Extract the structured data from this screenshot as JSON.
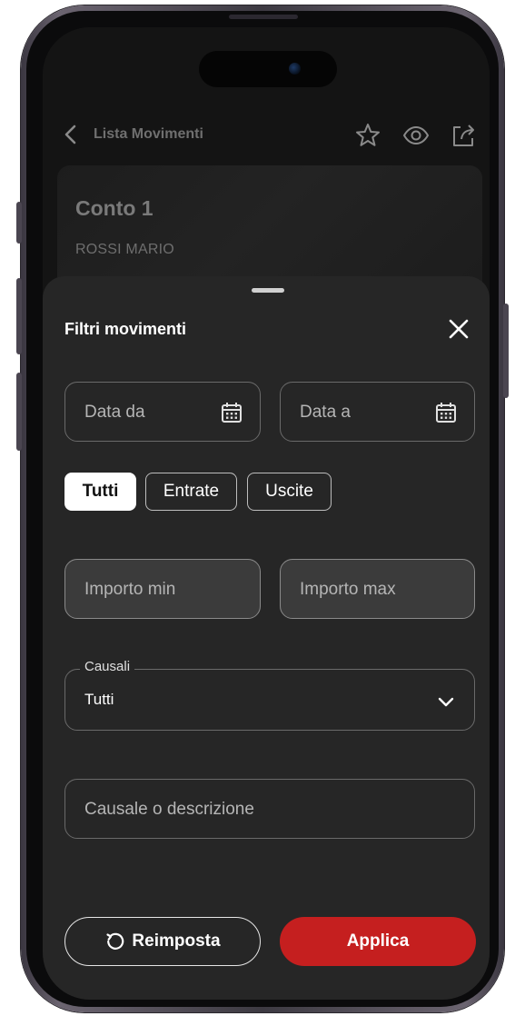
{
  "header": {
    "title": "Lista Movimenti",
    "icons": [
      "back-icon",
      "star-icon",
      "eye-icon",
      "share-icon"
    ]
  },
  "account": {
    "name": "Conto 1",
    "holder": "ROSSI MARIO"
  },
  "filter_sheet": {
    "title": "Filtri movimenti",
    "date_from_placeholder": "Data da",
    "date_to_placeholder": "Data a",
    "type_chips": [
      {
        "label": "Tutti",
        "selected": true
      },
      {
        "label": "Entrate",
        "selected": false
      },
      {
        "label": "Uscite",
        "selected": false
      }
    ],
    "amount_min_placeholder": "Importo min",
    "amount_max_placeholder": "Importo max",
    "causali": {
      "label": "Causali",
      "value": "Tutti"
    },
    "description_placeholder": "Causale o descrizione",
    "reset_label": "Reimposta",
    "apply_label": "Applica"
  },
  "colors": {
    "sheet_background": "#262626",
    "apply_button": "#c51f1f",
    "selected_chip": "#ffffff"
  }
}
